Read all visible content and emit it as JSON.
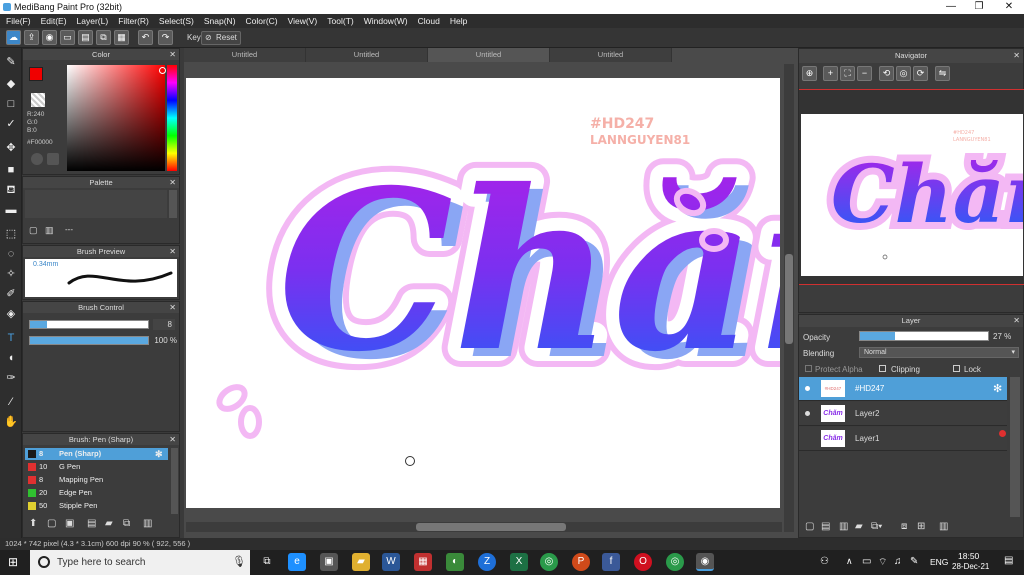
{
  "window": {
    "title": "MediBang Paint Pro (32bit)"
  },
  "menu": [
    "File(F)",
    "Edit(E)",
    "Layer(L)",
    "Filter(R)",
    "Select(S)",
    "Snap(N)",
    "Color(C)",
    "View(V)",
    "Tool(T)",
    "Window(W)",
    "Cloud",
    "Help"
  ],
  "toolbar": {
    "key_label": "Key",
    "reset_label": "Reset"
  },
  "color_panel": {
    "title": "Color",
    "r": "R:240",
    "g": "G:0",
    "b": "B:0",
    "hex": "#F00000",
    "primary": "#f00000"
  },
  "palette_panel": {
    "title": "Palette",
    "more": "---"
  },
  "brush_preview": {
    "title": "Brush Preview",
    "size": "0.34mm"
  },
  "brush_control": {
    "title": "Brush Control",
    "size_value": "8",
    "opacity_value": "100 %"
  },
  "brush_list": {
    "title": "Brush: Pen (Sharp)",
    "items": [
      {
        "size": "8",
        "name": "Pen (Sharp)",
        "color": "#1a1a1a"
      },
      {
        "size": "10",
        "name": "G Pen",
        "color": "#e03030"
      },
      {
        "size": "8",
        "name": "Mapping Pen",
        "color": "#e03030"
      },
      {
        "size": "20",
        "name": "Edge Pen",
        "color": "#30c030"
      },
      {
        "size": "50",
        "name": "Stipple Pen",
        "color": "#e0d030"
      }
    ]
  },
  "tabs": [
    "Untitled",
    "Untitled",
    "Untitled",
    "Untitled"
  ],
  "artwork": {
    "word": "Chăm",
    "tag_line1": "#HD247",
    "tag_line2": "LANNGUYEN81",
    "mini_word": "Chăm",
    "mini_tag1": "#HD247",
    "mini_tag2": "LANNGUYEN81"
  },
  "navigator": {
    "title": "Navigator"
  },
  "layer_panel": {
    "title": "Layer",
    "opacity_label": "Opacity",
    "opacity_value": "27 %",
    "opacity_fraction": 0.27,
    "blending_label": "Blending",
    "blending_value": "Normal",
    "protect_alpha": "Protect Alpha",
    "clipping": "Clipping",
    "lock": "Lock",
    "layers": [
      {
        "name": "#HD247",
        "thumb": "#HD247"
      },
      {
        "name": "Layer2",
        "thumb": "Chăm"
      },
      {
        "name": "Layer1",
        "thumb": "Chăm"
      }
    ]
  },
  "status": {
    "text": "1024 * 742 pixel   (4.3 * 3.1cm)  600 dpi   90 %   ( 922, 556 )"
  },
  "taskbar": {
    "search_placeholder": "Type here to search",
    "lang": "ENG",
    "time": "18:50",
    "date": "28-Dec-21"
  }
}
